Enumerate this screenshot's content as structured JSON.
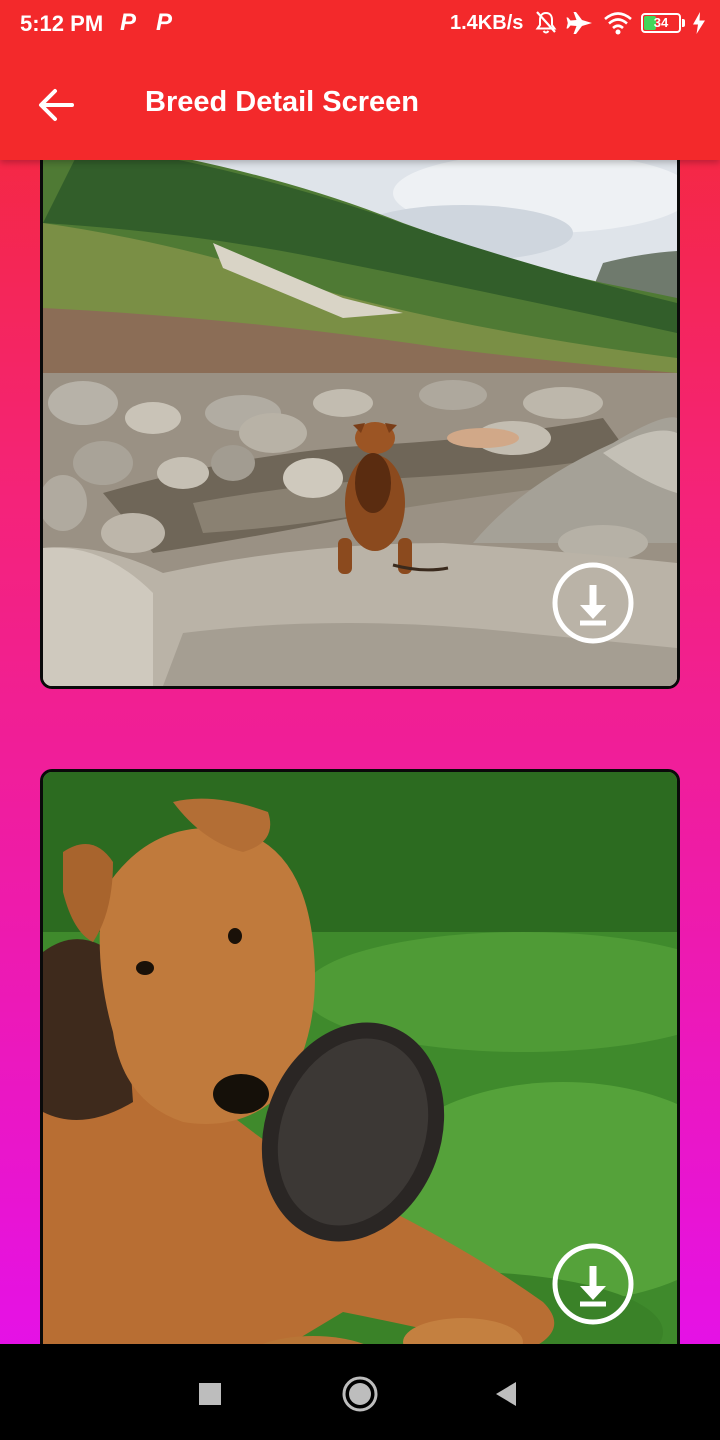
{
  "status_bar": {
    "time": "5:12 PM",
    "notification_icons": [
      "P",
      "P"
    ],
    "network_speed": "1.4KB/s",
    "battery_level": "34",
    "icons": [
      "mute-icon",
      "airplane-icon",
      "wifi-icon",
      "battery-icon",
      "charging-icon"
    ]
  },
  "app_bar": {
    "title": "Breed Detail Screen",
    "back_icon": "arrow-back-icon"
  },
  "gallery": {
    "items": [
      {
        "image": "dog sitting on rocks by a mountain stream",
        "download_icon": "download-circle-icon"
      },
      {
        "image": "dog lying on grass holding a frisbee",
        "download_icon": "download-circle-icon"
      }
    ]
  },
  "nav_bar": {
    "buttons": [
      "recents-square-icon",
      "home-circle-icon",
      "back-triangle-icon"
    ]
  },
  "colors": {
    "app_bar": "#f3292b",
    "gradient_top": "#f52a2e",
    "gradient_bottom": "#e30ff3",
    "card_border": "#0a0a0a"
  }
}
